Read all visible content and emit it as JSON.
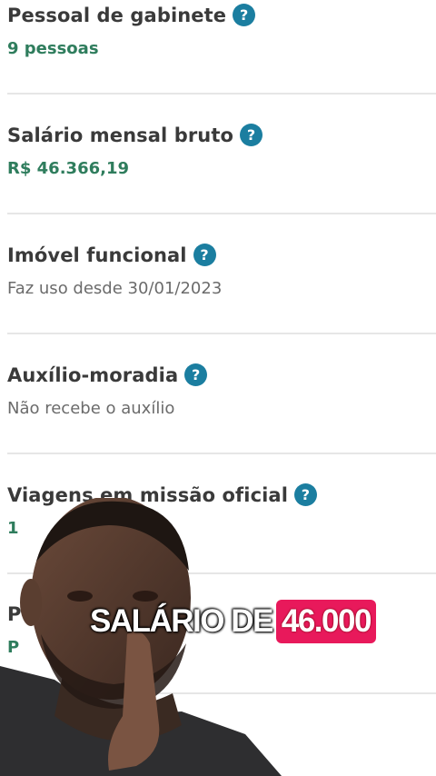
{
  "fields": [
    {
      "title": "Pessoal de gabinete",
      "value": "9 pessoas",
      "style": "green"
    },
    {
      "title": "Salário mensal bruto",
      "value": "R$ 46.366,19",
      "style": "green"
    },
    {
      "title": "Imóvel funcional",
      "value": "Faz uso desde 30/01/2023",
      "style": "gray"
    },
    {
      "title": "Auxílio-moradia",
      "value": "Não recebe o auxílio",
      "style": "gray"
    },
    {
      "title": "Viagens em missão oficial",
      "value": "1",
      "style": "green"
    }
  ],
  "partial_row": {
    "title_fragment": "P",
    "value_fragment": "P"
  },
  "help_icon_glyph": "?",
  "caption": {
    "text": "SALÁRIO DE",
    "highlight": "46.000"
  },
  "colors": {
    "title": "#3a3a3a",
    "green_value": "#2f7d5d",
    "gray_value": "#6b6b6b",
    "help_icon": "#1b7ea0",
    "highlight": "#e8195b"
  }
}
